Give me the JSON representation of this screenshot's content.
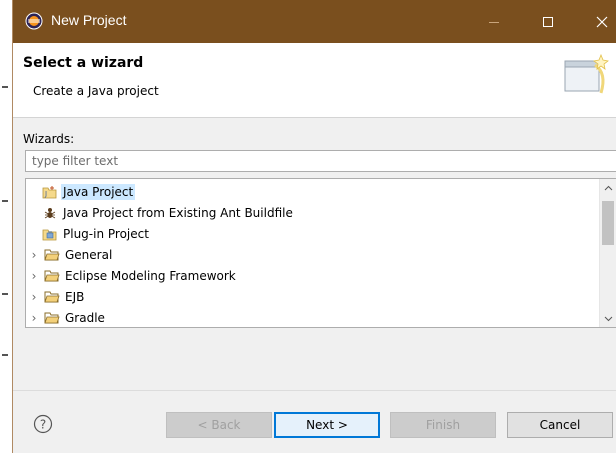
{
  "window": {
    "title": "New Project"
  },
  "header": {
    "title": "Select a wizard",
    "description": "Create a Java project"
  },
  "wizards": {
    "label": "Wizards:",
    "filter_placeholder": "type filter text",
    "filter_value": ""
  },
  "tree": {
    "items": [
      {
        "label": "Java Project",
        "icon": "java-project-icon",
        "expandable": false,
        "selected": true
      },
      {
        "label": "Java Project from Existing Ant Buildfile",
        "icon": "ant-buildfile-icon",
        "expandable": false,
        "selected": false
      },
      {
        "label": "Plug-in Project",
        "icon": "plugin-project-icon",
        "expandable": false,
        "selected": false
      },
      {
        "label": "General",
        "icon": "folder-icon",
        "expandable": true,
        "selected": false
      },
      {
        "label": "Eclipse Modeling Framework",
        "icon": "folder-icon",
        "expandable": true,
        "selected": false
      },
      {
        "label": "EJB",
        "icon": "folder-icon",
        "expandable": true,
        "selected": false
      },
      {
        "label": "Gradle",
        "icon": "folder-icon",
        "expandable": true,
        "selected": false
      }
    ]
  },
  "buttons": {
    "back": "< Back",
    "next": "Next >",
    "finish": "Finish",
    "cancel": "Cancel"
  },
  "colors": {
    "titlebar": "#7a4f1e",
    "selection": "#cce8ff",
    "default_button_border": "#0078d7"
  }
}
